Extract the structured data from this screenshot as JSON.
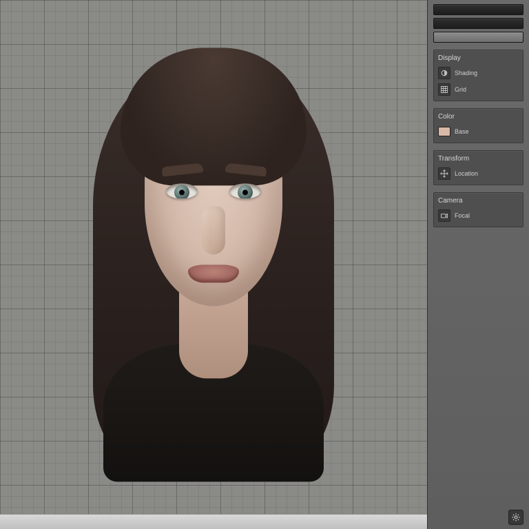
{
  "viewport": {
    "status": ""
  },
  "toolbar": {
    "slot1": "",
    "slot2": "",
    "slot3": ""
  },
  "panels": {
    "display": {
      "title": "Display",
      "shading_label": "Shading",
      "grid_label": "Grid"
    },
    "color": {
      "title": "Color",
      "base_label": "Base",
      "base_value": "#d9b9a6"
    },
    "transform": {
      "title": "Transform",
      "location_label": "Location"
    },
    "camera": {
      "title": "Camera",
      "focal_label": "Focal"
    }
  }
}
